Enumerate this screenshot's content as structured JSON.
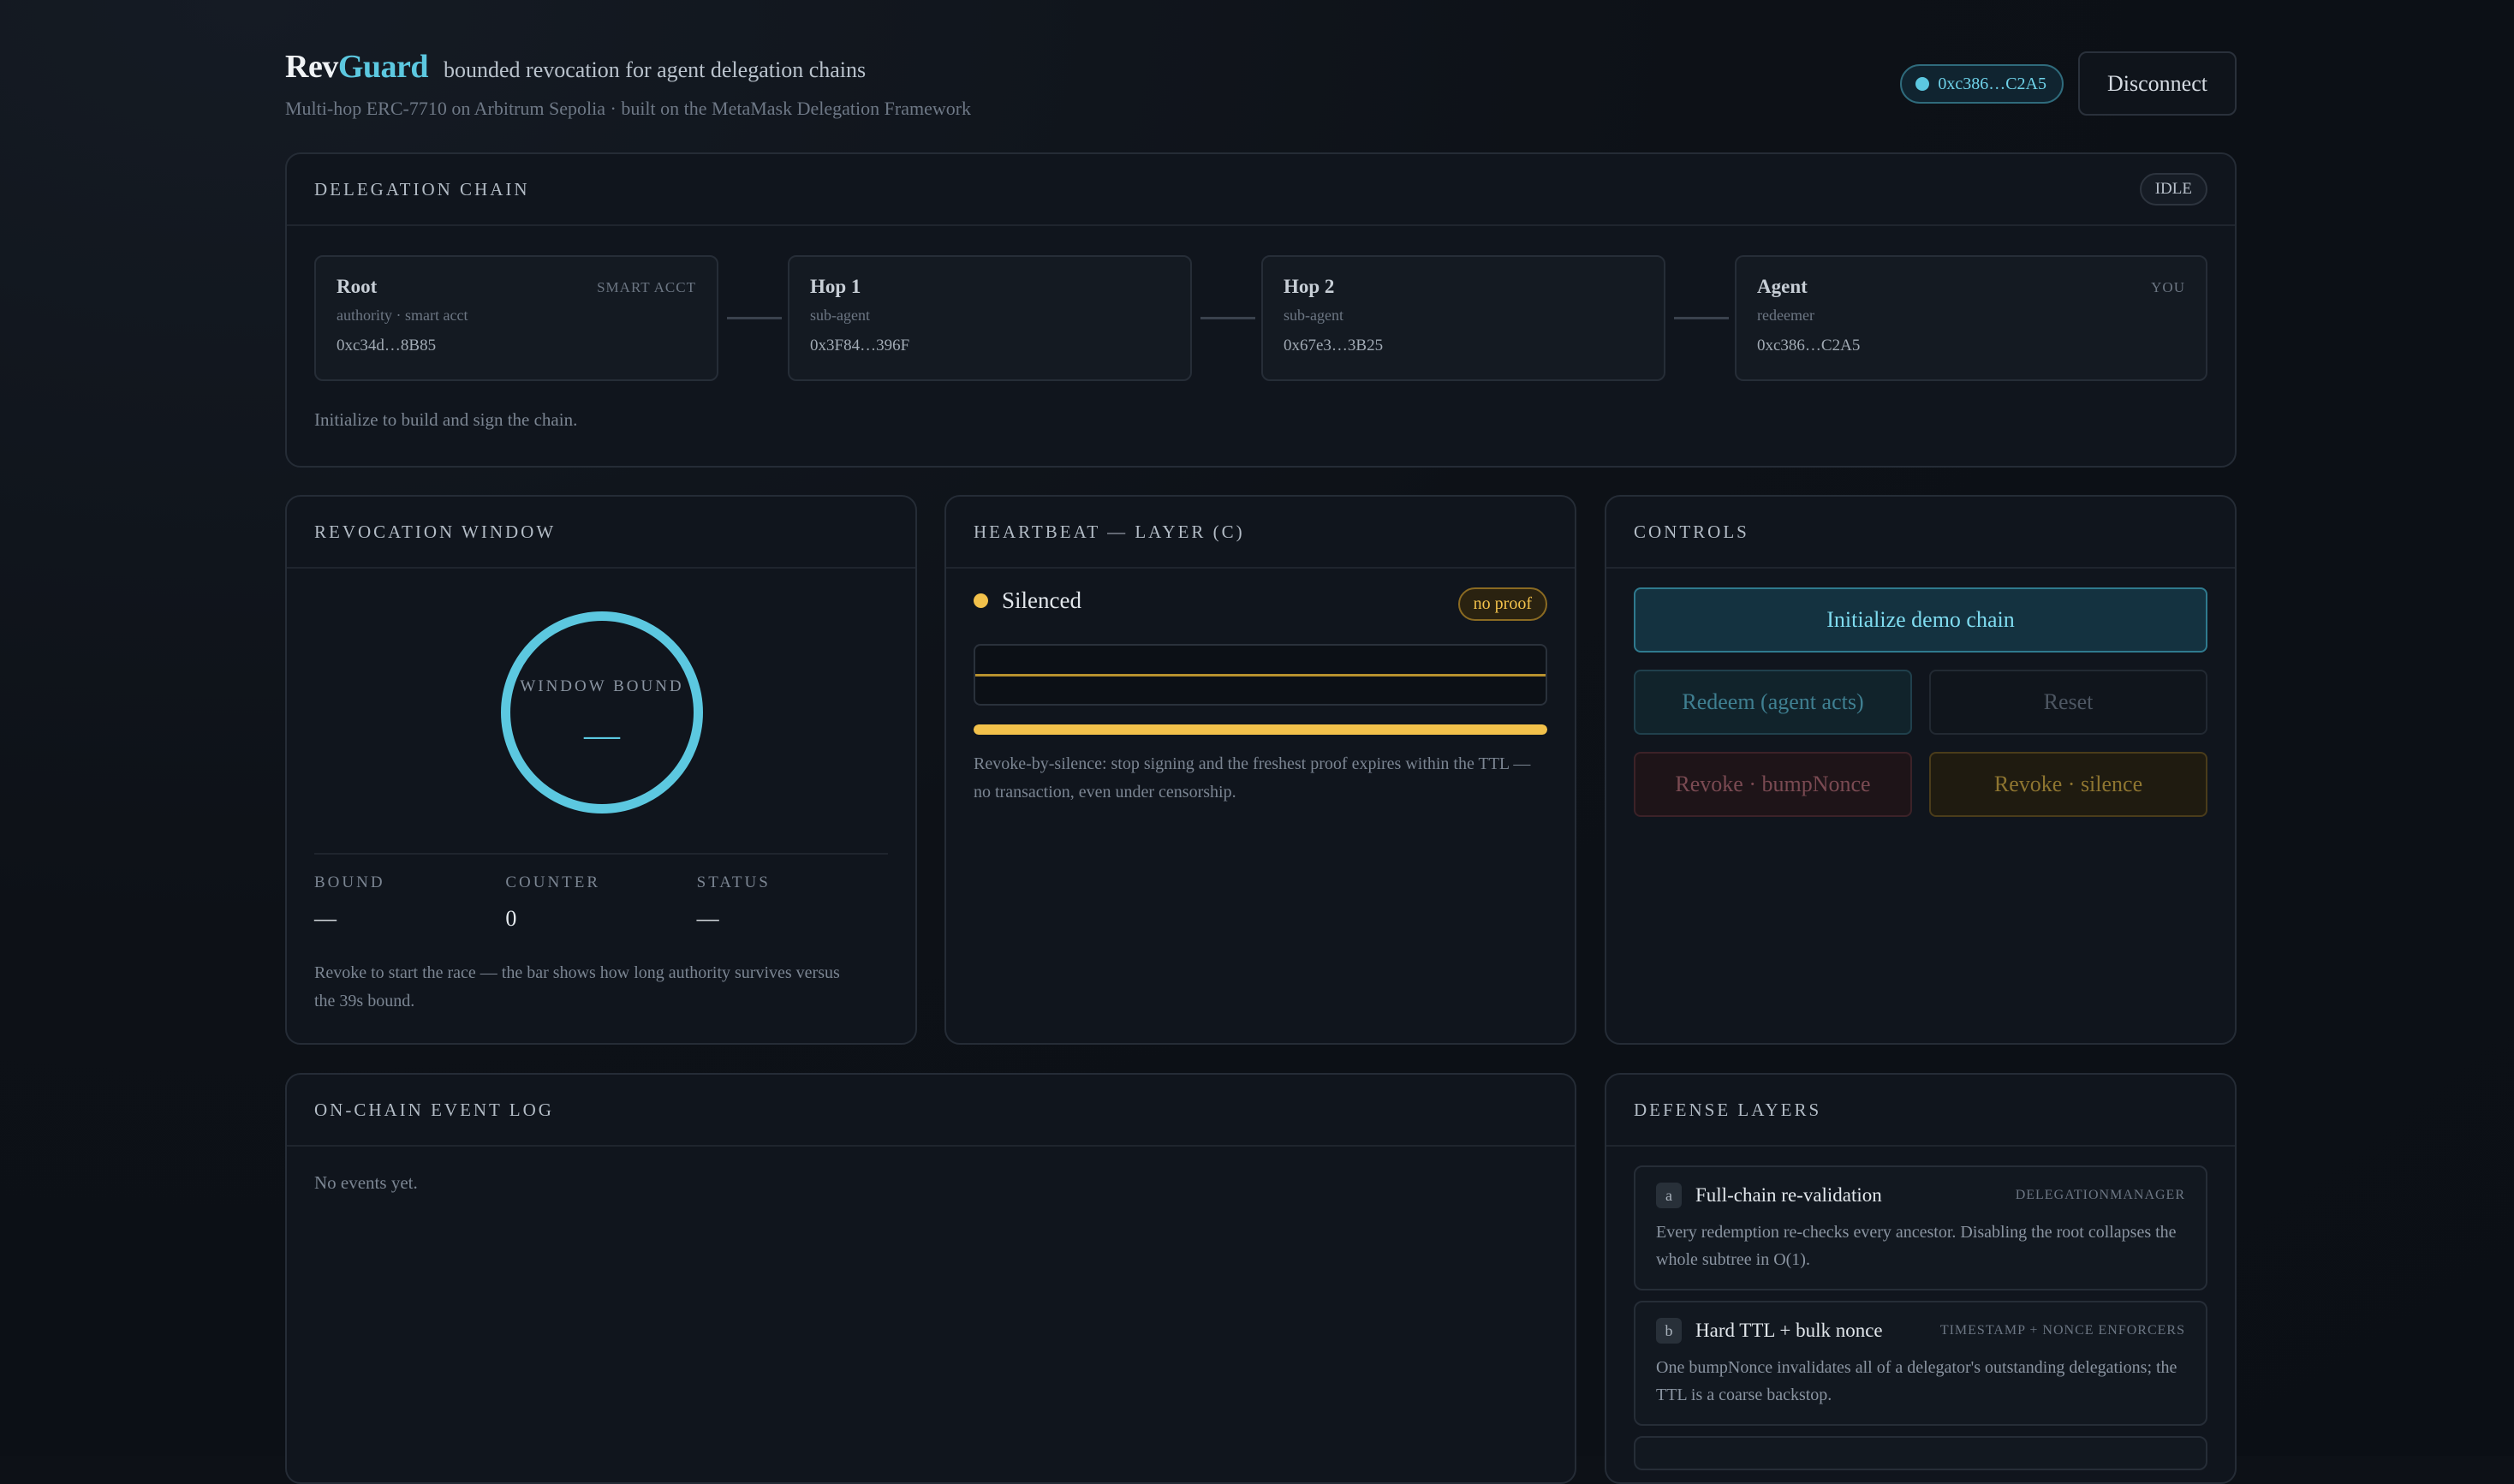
{
  "header": {
    "brand_prefix": "Rev",
    "brand_accent": "Guard",
    "tagline": "bounded revocation for agent delegation chains",
    "subtitle": "Multi-hop ERC-7710 on Arbitrum Sepolia · built on the MetaMask Delegation Framework",
    "wallet_address": "0xc386…C2A5",
    "disconnect_label": "Disconnect"
  },
  "delegation_chain": {
    "title": "DELEGATION CHAIN",
    "status": "IDLE",
    "nodes": [
      {
        "name": "Root",
        "tag": "SMART ACCT",
        "role": "authority · smart acct",
        "address": "0xc34d…8B85"
      },
      {
        "name": "Hop 1",
        "tag": "",
        "role": "sub-agent",
        "address": "0x3F84…396F"
      },
      {
        "name": "Hop 2",
        "tag": "",
        "role": "sub-agent",
        "address": "0x67e3…3B25"
      },
      {
        "name": "Agent",
        "tag": "YOU",
        "role": "redeemer",
        "address": "0xc386…C2A5"
      }
    ],
    "note": "Initialize to build and sign the chain."
  },
  "revocation_window": {
    "title": "REVOCATION WINDOW",
    "ring_label": "WINDOW BOUND",
    "ring_value": "—",
    "stats": [
      {
        "label": "BOUND",
        "value": "—"
      },
      {
        "label": "COUNTER",
        "value": "0"
      },
      {
        "label": "STATUS",
        "value": "—"
      }
    ],
    "note": "Revoke to start the race — the bar shows how long authority survives versus the 39s bound."
  },
  "heartbeat": {
    "title": "HEARTBEAT — LAYER (C)",
    "status": "Silenced",
    "badge": "no proof",
    "progress": 1.0,
    "note": "Revoke-by-silence: stop signing and the freshest proof expires within the TTL — no transaction, even under censorship."
  },
  "controls": {
    "title": "CONTROLS",
    "init_label": "Initialize demo chain",
    "redeem_label": "Redeem (agent acts)",
    "reset_label": "Reset",
    "bump_label": "Revoke · bumpNonce",
    "silence_label": "Revoke · silence"
  },
  "event_log": {
    "title": "ON-CHAIN EVENT LOG",
    "empty_text": "No events yet."
  },
  "defense_layers": {
    "title": "DEFENSE LAYERS",
    "layers": [
      {
        "key": "a",
        "name": "Full-chain re-validation",
        "tag": "DELEGATIONMANAGER",
        "desc": "Every redemption re-checks every ancestor. Disabling the root collapses the whole subtree in O(1)."
      },
      {
        "key": "b",
        "name": "Hard TTL + bulk nonce",
        "tag": "TIMESTAMP + NONCE ENFORCERS",
        "desc": "One bumpNonce invalidates all of a delegator's outstanding delegations; the TTL is a coarse backstop."
      }
    ]
  },
  "colors": {
    "accent": "#5cc8e0",
    "amber": "#f2c14b",
    "danger": "#7a4a52",
    "background": "#0d1117"
  }
}
